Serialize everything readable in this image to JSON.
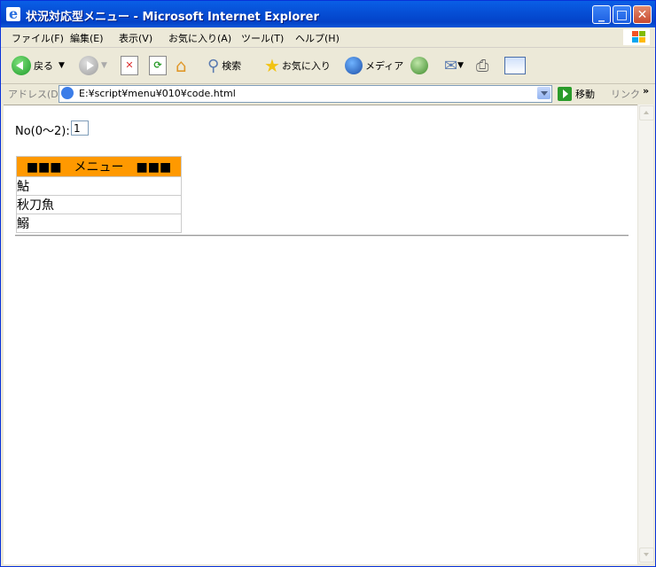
{
  "window": {
    "title": "状況対応型メニュー - Microsoft Internet Explorer"
  },
  "menubar": [
    "ファイル(F)",
    "編集(E)",
    "表示(V)",
    "お気に入り(A)",
    "ツール(T)",
    "ヘルプ(H)"
  ],
  "toolbar": {
    "back": "戻る",
    "search": "検索",
    "favorites": "お気に入り",
    "media": "メディア"
  },
  "address": {
    "label": "アドレス(D)",
    "url": "E:¥script¥menu¥010¥code.html",
    "go": "移動",
    "links": "リンク",
    "chevron": "»"
  },
  "page": {
    "no_label": "No(0〜2):",
    "no_value": "1",
    "table_header": "■■■　メニュー　■■■",
    "rows": [
      "鮎",
      "秋刀魚",
      "鰯"
    ]
  }
}
